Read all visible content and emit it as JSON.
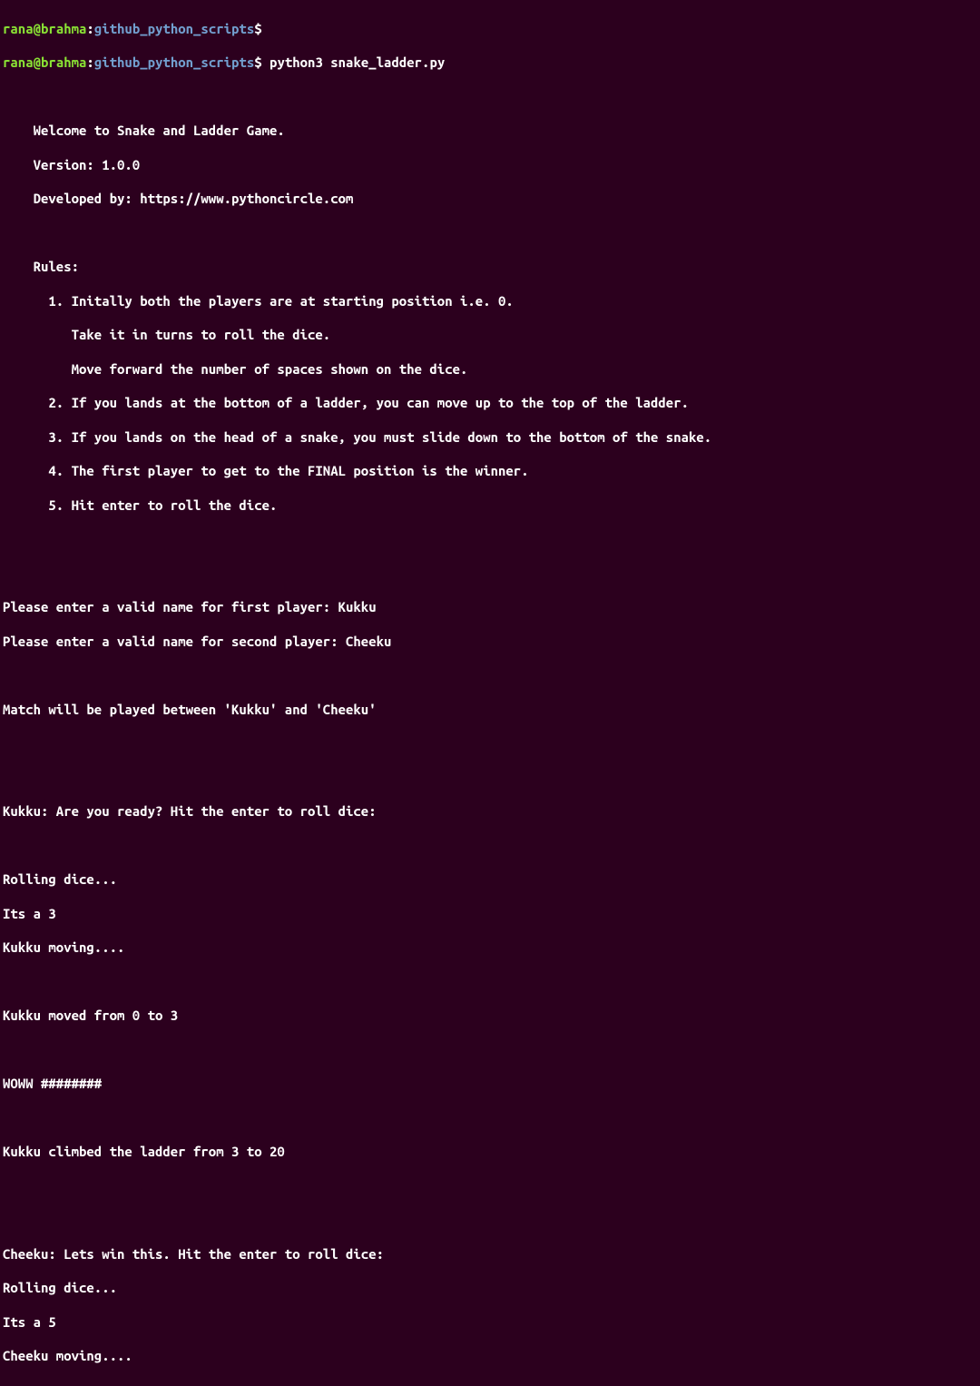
{
  "prompt1": {
    "user": "rana",
    "at": "@",
    "host": "brahma",
    "path": "github_python_scripts",
    "dollar": "$",
    "command": ""
  },
  "prompt2": {
    "user": "rana",
    "at": "@",
    "host": "brahma",
    "path": "github_python_scripts",
    "dollar": "$",
    "command": " python3 snake_ladder.py"
  },
  "output": {
    "blank1": "",
    "welcome": "    Welcome to Snake and Ladder Game.",
    "version": "    Version: 1.0.0",
    "developed": "    Developed by: https://www.pythoncircle.com",
    "blank2": "",
    "rules_header": "    Rules:",
    "rule1a": "      1. Initally both the players are at starting position i.e. 0.",
    "rule1b": "         Take it in turns to roll the dice.",
    "rule1c": "         Move forward the number of spaces shown on the dice.",
    "rule2": "      2. If you lands at the bottom of a ladder, you can move up to the top of the ladder.",
    "rule3": "      3. If you lands on the head of a snake, you must slide down to the bottom of the snake.",
    "rule4": "      4. The first player to get to the FINAL position is the winner.",
    "rule5": "      5. Hit enter to roll the dice.",
    "blank3": "",
    "blank4": "",
    "player1_prompt": "Please enter a valid name for first player: Kukku",
    "player2_prompt": "Please enter a valid name for second player: Cheeku",
    "blank5": "",
    "match": "Match will be played between 'Kukku' and 'Cheeku'",
    "blank6": "",
    "blank7": "",
    "kukku_ready": "Kukku: Are you ready? Hit the enter to roll dice: ",
    "blank8": "",
    "rolling1": "Rolling dice...",
    "its3": "Its a 3",
    "kukku_moving": "Kukku moving....",
    "blank9": "",
    "kukku_moved": "Kukku moved from 0 to 3",
    "blank10": "",
    "woww": "WOWW ########",
    "blank11": "",
    "kukku_climbed": "Kukku climbed the ladder from 3 to 20",
    "blank12": "",
    "blank13": "",
    "cheeku_ready": "Cheeku: Lets win this. Hit the enter to roll dice: ",
    "rolling2": "Rolling dice...",
    "its5": "Its a 5",
    "cheeku_moving": "Cheeku moving...."
  }
}
